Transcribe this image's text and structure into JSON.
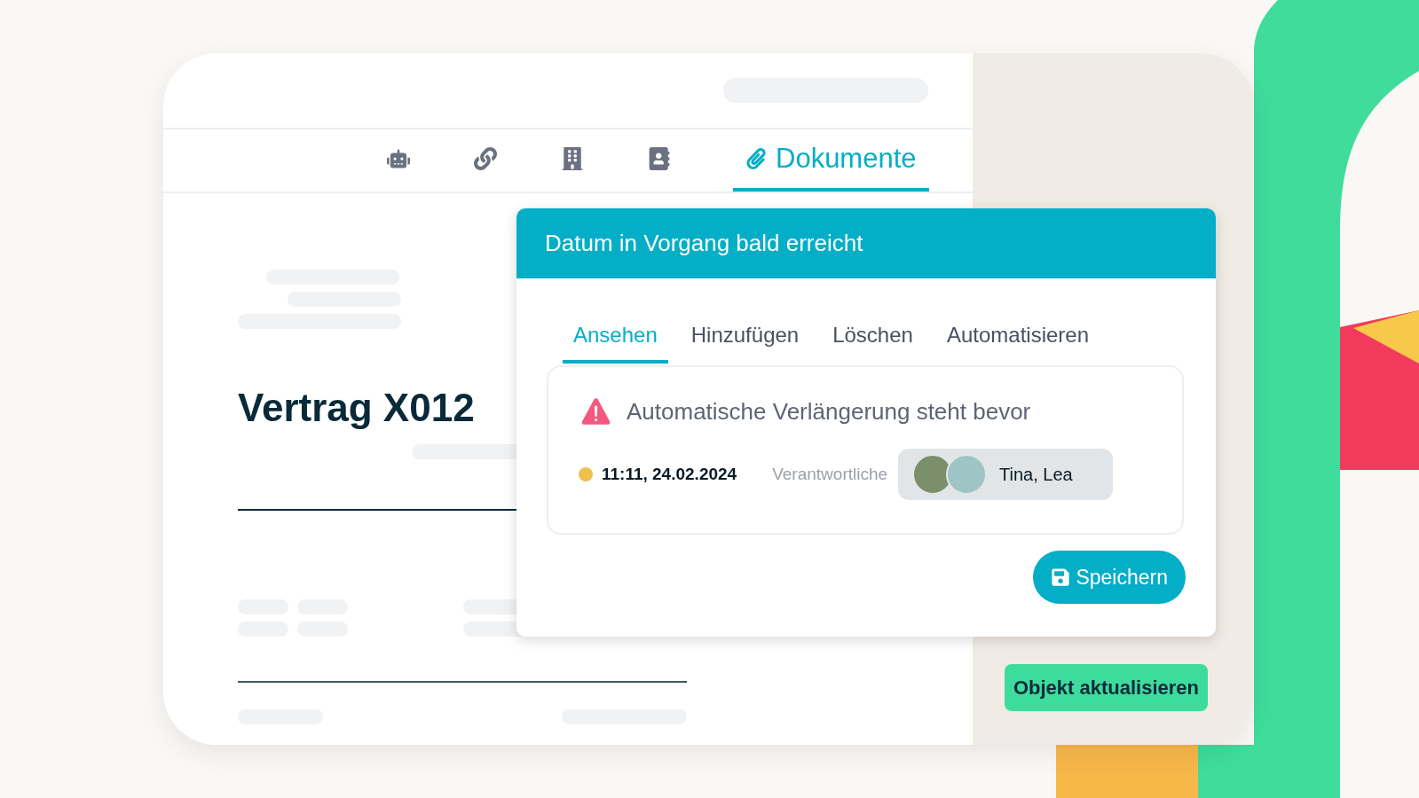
{
  "nav_tabs": [
    {
      "selected": false
    },
    {
      "selected": false
    },
    {
      "selected": false
    },
    {
      "selected": false
    },
    {
      "label": "Dokumente",
      "selected": true
    }
  ],
  "document": {
    "title": "Vertrag X012"
  },
  "dialog": {
    "title": "Datum in Vorgang bald erreicht",
    "tabs": [
      {
        "label": "Ansehen",
        "selected": true
      },
      {
        "label": "Hinzufügen",
        "selected": false
      },
      {
        "label": "Löschen",
        "selected": false
      },
      {
        "label": "Automatisieren",
        "selected": false
      }
    ],
    "alert": {
      "message": "Automatische Verlängerung steht bevor",
      "date": "11:11, 24.02.2024",
      "color": "#efc04f",
      "assignee_label": "Verantwortliche",
      "assignees": "Tina, Lea"
    },
    "save_button": "Speichern"
  },
  "update_button": "Objekt aktualisieren"
}
